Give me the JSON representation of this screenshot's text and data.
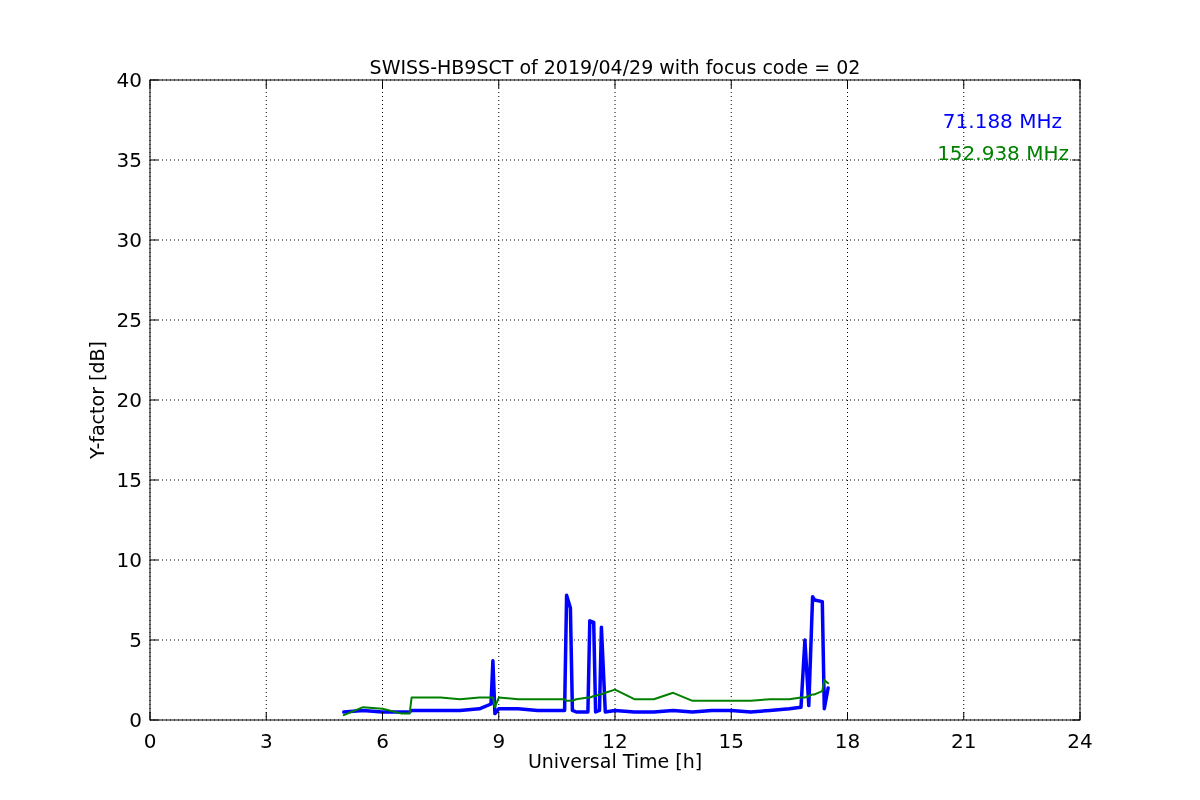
{
  "chart_data": {
    "type": "line",
    "title": "SWISS-HB9SCT of 2019/04/29 with focus code = 02",
    "xlabel": "Universal Time [h]",
    "ylabel": "Y-factor [dB]",
    "x": [
      5.0,
      5.5,
      6.0,
      6.5,
      6.7,
      6.75,
      7.0,
      7.5,
      8.0,
      8.5,
      8.8,
      8.85,
      8.9,
      9.0,
      9.5,
      10.0,
      10.5,
      10.7,
      10.75,
      10.85,
      10.9,
      11.0,
      11.3,
      11.35,
      11.45,
      11.5,
      11.6,
      11.65,
      11.75,
      12.0,
      12.5,
      13.0,
      13.5,
      14.0,
      14.5,
      15.0,
      15.5,
      16.0,
      16.5,
      16.8,
      16.9,
      17.0,
      17.1,
      17.15,
      17.35,
      17.4,
      17.5
    ],
    "series": [
      {
        "name": "71.188 MHz",
        "color": "#0000ff",
        "values": [
          0.5,
          0.6,
          0.5,
          0.5,
          0.5,
          0.6,
          0.6,
          0.6,
          0.6,
          0.7,
          1.0,
          3.7,
          0.4,
          0.7,
          0.7,
          0.6,
          0.6,
          0.6,
          7.8,
          7.0,
          0.6,
          0.5,
          0.5,
          6.2,
          6.1,
          0.5,
          0.6,
          5.8,
          0.5,
          0.6,
          0.5,
          0.5,
          0.6,
          0.5,
          0.6,
          0.6,
          0.5,
          0.6,
          0.7,
          0.8,
          5.0,
          0.9,
          7.7,
          7.5,
          7.4,
          0.7,
          2.0
        ]
      },
      {
        "name": "152.938 MHz",
        "color": "#008000",
        "values": [
          0.3,
          0.8,
          0.7,
          0.4,
          0.4,
          1.4,
          1.4,
          1.4,
          1.3,
          1.4,
          1.4,
          1.4,
          0.8,
          1.4,
          1.3,
          1.3,
          1.3,
          1.3,
          1.2,
          1.2,
          1.2,
          1.3,
          1.4,
          1.4,
          1.5,
          1.5,
          1.6,
          1.6,
          1.7,
          1.9,
          1.3,
          1.3,
          1.7,
          1.2,
          1.2,
          1.2,
          1.2,
          1.3,
          1.3,
          1.4,
          1.4,
          1.5,
          1.6,
          1.6,
          1.8,
          2.5,
          2.3
        ]
      }
    ],
    "xlim": [
      0,
      24
    ],
    "ylim": [
      0,
      40
    ],
    "xticks": [
      0,
      3,
      6,
      9,
      12,
      15,
      18,
      21,
      24
    ],
    "yticks": [
      0,
      5,
      10,
      15,
      20,
      25,
      30,
      35,
      40
    ],
    "grid": true
  }
}
